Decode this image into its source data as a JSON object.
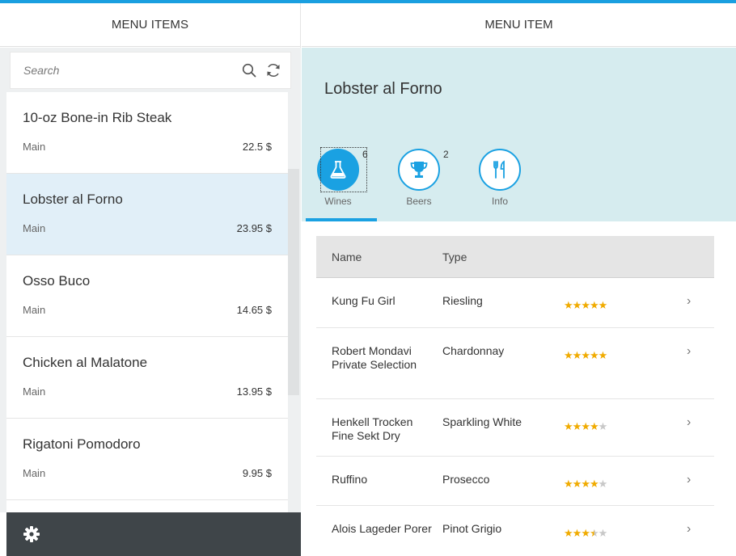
{
  "master": {
    "title": "MENU ITEMS",
    "search": {
      "placeholder": "Search"
    },
    "items": [
      {
        "name": "10-oz Bone-in Rib Steak",
        "category": "Main",
        "price": "22.5 $",
        "selected": false
      },
      {
        "name": "Lobster al Forno",
        "category": "Main",
        "price": "23.95 $",
        "selected": true
      },
      {
        "name": "Osso Buco",
        "category": "Main",
        "price": "14.65 $",
        "selected": false
      },
      {
        "name": "Chicken al Malatone",
        "category": "Main",
        "price": "13.95 $",
        "selected": false
      },
      {
        "name": "Rigatoni Pomodoro",
        "category": "Main",
        "price": "9.95 $",
        "selected": false
      }
    ]
  },
  "detail": {
    "title": "MENU ITEM",
    "object_title": "Lobster al Forno",
    "tabs": [
      {
        "label": "Wines",
        "count": "6",
        "icon": "flask-icon",
        "active": true
      },
      {
        "label": "Beers",
        "count": "2",
        "icon": "trophy-icon",
        "active": false
      },
      {
        "label": "Info",
        "count": "",
        "icon": "cutlery-icon",
        "active": false
      }
    ],
    "table": {
      "columns": [
        "Name",
        "Type"
      ],
      "rows": [
        {
          "name": "Kung Fu Girl",
          "type": "Riesling",
          "rating": 5
        },
        {
          "name": "Robert Mondavi Private Selection",
          "type": "Chardonnay",
          "rating": 5
        },
        {
          "name": "Henkell Trocken Fine Sekt Dry",
          "type": "Sparkling White",
          "rating": 4
        },
        {
          "name": "Ruffino",
          "type": "Prosecco",
          "rating": 4
        },
        {
          "name": "Alois Lageder Porer",
          "type": "Pinot Grigio",
          "rating": 3.5
        }
      ]
    }
  },
  "colors": {
    "accent": "#1aa1e2",
    "selected_row": "#e1eff8",
    "object_header": "#d6ecef",
    "footer": "#3f4549",
    "star": "#f0ab00"
  },
  "icons": {
    "search": "search-icon",
    "refresh": "refresh-icon",
    "settings": "gear-icon",
    "row_nav": "chevron-right-icon"
  }
}
